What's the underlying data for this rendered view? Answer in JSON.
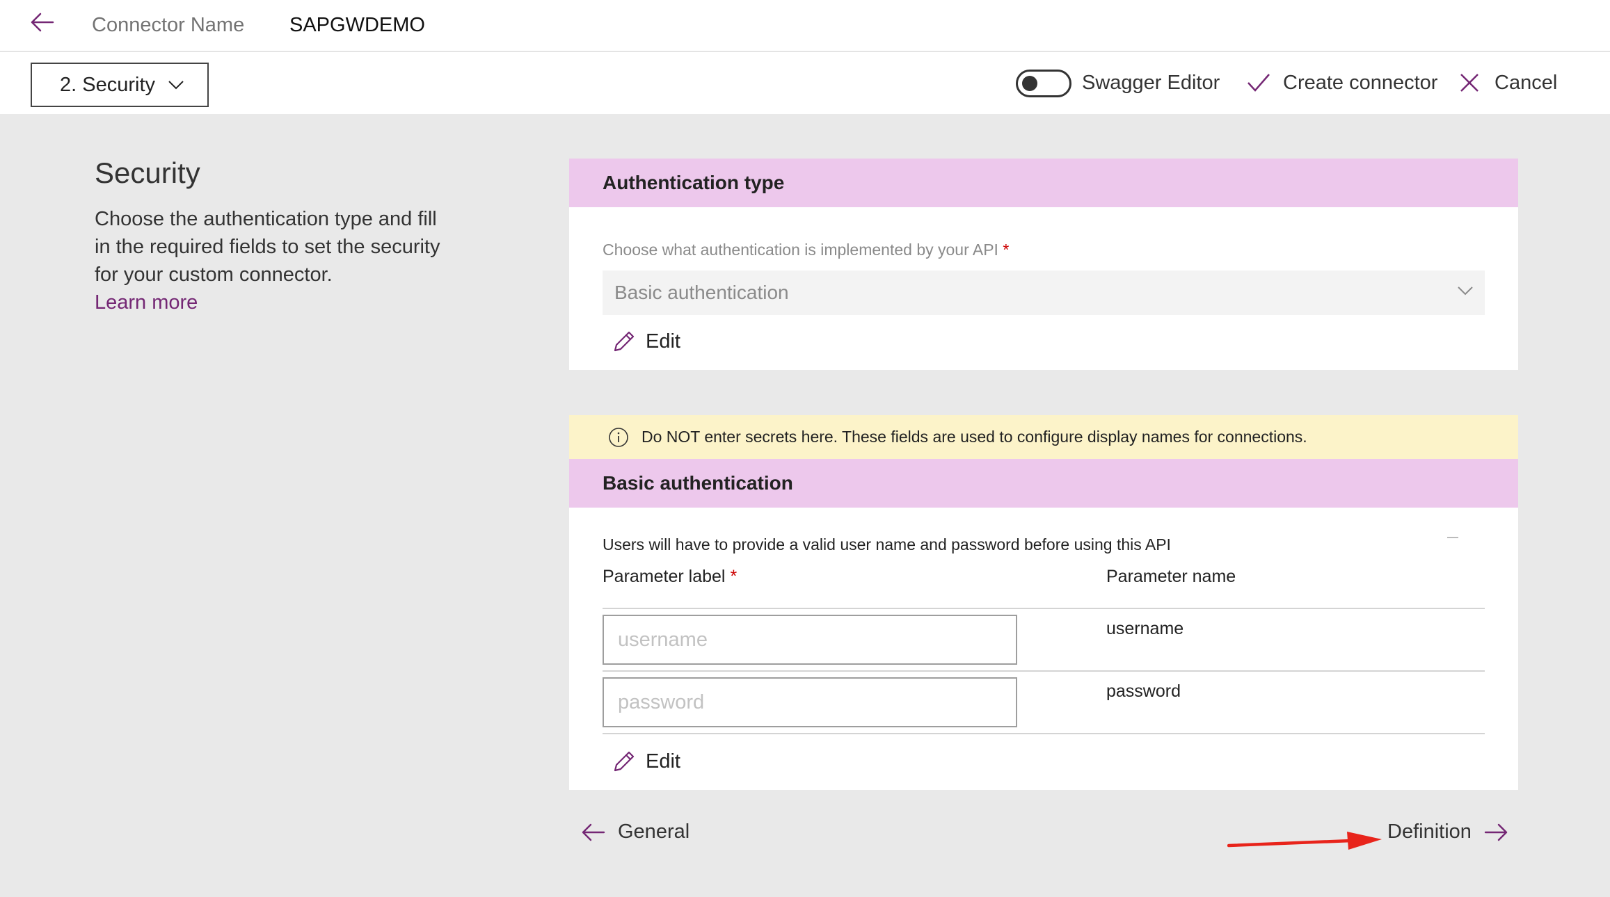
{
  "header": {
    "connector_name_label": "Connector Name",
    "connector_name_value": "SAPGWDEMO"
  },
  "toolbar": {
    "step_label": "2. Security",
    "swagger_label": "Swagger Editor",
    "swagger_on": false,
    "create_label": "Create connector",
    "cancel_label": "Cancel"
  },
  "intro": {
    "title": "Security",
    "description": "Choose the authentication type and fill in the required fields to set the security for your custom connector.",
    "learn_more": "Learn more"
  },
  "auth_type": {
    "header": "Authentication type",
    "field_label": "Choose what authentication is implemented by your API",
    "required_mark": "*",
    "selected": "Basic authentication",
    "edit_label": "Edit"
  },
  "warning": {
    "text": "Do NOT enter secrets here. These fields are used to configure display names for connections."
  },
  "basic_auth": {
    "header": "Basic authentication",
    "description": "Users will have to provide a valid user name and password before using this API",
    "col_label": "Parameter label",
    "required_mark": "*",
    "col_name": "Parameter name",
    "rows": [
      {
        "placeholder": "username",
        "value": "",
        "name": "username"
      },
      {
        "placeholder": "password",
        "value": "",
        "name": "password"
      }
    ],
    "edit_label": "Edit"
  },
  "footer": {
    "prev_label": "General",
    "next_label": "Definition"
  },
  "colors": {
    "accent": "#742774",
    "section_header": "#edc8ec",
    "warning_bg": "#fcf3c9",
    "annotation_arrow": "#e8241b"
  }
}
